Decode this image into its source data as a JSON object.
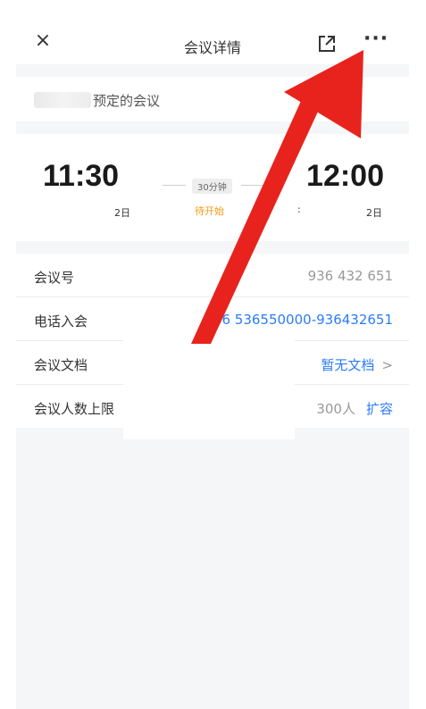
{
  "navbar": {
    "close_glyph": "×",
    "title": "会议详情",
    "more_glyph": "···",
    "icons": [
      "close-icon",
      "share-icon",
      "more-icon"
    ]
  },
  "organizer": {
    "suffix": "预定的会议"
  },
  "time": {
    "start_time": "11:30",
    "start_date": "2日",
    "end_time": "12:00",
    "end_date": "2日",
    "end_partial": ":",
    "duration": "30分钟",
    "status": "待开始"
  },
  "info": {
    "meeting_id_label": "会议号",
    "meeting_id_value": "936 432 651",
    "phone_label": "电话入会",
    "phone_value": "+86 536550000-936432651",
    "docs_label": "会议文档",
    "docs_value": "暂无文档",
    "docs_chevron": ">",
    "capacity_label": "会议人数上限",
    "capacity_value": "300人",
    "capacity_action": "扩容"
  },
  "colors": {
    "accent": "#2b7cf6",
    "status": "#f39c12",
    "annotation_arrow": "#e8231d"
  }
}
